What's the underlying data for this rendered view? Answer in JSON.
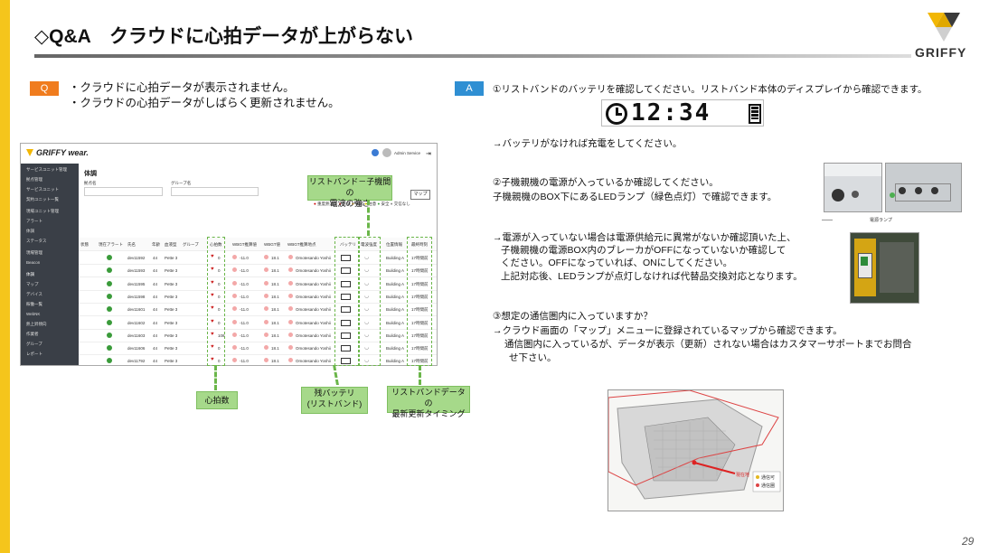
{
  "title": "◇Q&A　クラウドに心拍データが上がらない",
  "logo": {
    "name": "GRIFFY",
    "colors": [
      "#f2b705",
      "#3a3a3a",
      "#cfcfcf"
    ]
  },
  "question": {
    "badge": "Q",
    "lines": [
      "・クラウドに心拍データが表示されません。",
      "・クラウドの心拍データがしばらく更新されません。"
    ]
  },
  "answer": {
    "badge": "A",
    "step1": "①リストバンドのバッテリを確認してください。リストバンド本体のディスプレイから確認できます。",
    "display_time": "12:34",
    "step1_note": "→バッテリがなければ充電をしてください。",
    "step2_line1": "②子機親機の電源が入っているか確認してください。",
    "step2_line2": "子機親機のBOX下にあるLEDランプ（緑色点灯）で確認できます。",
    "photo_caption": "電源ランプ",
    "step2_note": [
      "→電源が入っていない場合は電源供給元に異常がないか確認頂いた上、",
      "子機親機の電源BOX内のブレーカがOFFになっていないか確認して",
      "ください。OFFになっていれば、ONにしてください。",
      "上記対応後、LEDランプが点灯しなければ代替品交換対応となります。"
    ],
    "step3_line1": "③想定の通信圏内に入っていますか？",
    "step3_line2": "→クラウド画面の「マップ」メニューに登録されているマップから確認できます。",
    "step3_line3": "通信圏内に入っているが、データが表示（更新）されない場合はカスタマーサポートまでお問合",
    "step3_line4": "せ下さい。"
  },
  "screenshot": {
    "brand": "GRIFFY wear.",
    "user": "Admin Service",
    "page_title": "体調",
    "filter1": "拠点名",
    "filter2": "グループ名",
    "map_button": "マップ",
    "legend": [
      "重度熱注意",
      "危険",
      "警戒",
      "注意",
      "安全",
      "交信なし"
    ],
    "sidebar": [
      "サービスユニット管理",
      "拠点管理",
      "サービスユニット",
      "契約ユニット一覧",
      "現場ユニット管理",
      "アラート",
      "体調",
      "ステータス",
      "現場管理",
      "Beacon",
      "体調",
      "マップ",
      "デバイス",
      "稼働一覧",
      "WebNK",
      "熱上昇傾向",
      "作業者",
      "グループ",
      "レポート"
    ],
    "columns": [
      "状態",
      "現在アラート",
      "氏名",
      "年齢",
      "血液型",
      "グループ",
      "心拍数",
      "WBGT推算値",
      "WBGT値",
      "WBGT推算地点",
      "バッテリ",
      "電波強度",
      "位置情報",
      "最終時刻"
    ],
    "rows": [
      {
        "name": "dev11592",
        "age": "44",
        "group": "Pette 3",
        "hr": "0",
        "wbgt": "-11.0",
        "temp": "18.1",
        "place": "Omotesando Yoshii",
        "loc": "Building A",
        "time": "17時間前"
      },
      {
        "name": "dev11593",
        "age": "44",
        "group": "Pette 3",
        "hr": "0",
        "wbgt": "-11.0",
        "temp": "18.1",
        "place": "Omotesando Yoshii",
        "loc": "Building A",
        "time": "17時間前"
      },
      {
        "name": "dev11595",
        "age": "44",
        "group": "Pette 3",
        "hr": "0",
        "wbgt": "-11.0",
        "temp": "18.1",
        "place": "Omotesando Yoshii",
        "loc": "Building A",
        "time": "17時間前"
      },
      {
        "name": "dev11598",
        "age": "44",
        "group": "Pette 3",
        "hr": "0",
        "wbgt": "-11.0",
        "temp": "18.1",
        "place": "Omotesando Yoshii",
        "loc": "Building A",
        "time": "17時間前"
      },
      {
        "name": "dev11601",
        "age": "44",
        "group": "Pette 3",
        "hr": "0",
        "wbgt": "-11.0",
        "temp": "18.1",
        "place": "Omotesando Yoshii",
        "loc": "Building A",
        "time": "17時間前"
      },
      {
        "name": "dev11602",
        "age": "44",
        "group": "Pette 3",
        "hr": "0",
        "wbgt": "-11.0",
        "temp": "18.1",
        "place": "Omotesando Yoshii",
        "loc": "Building A",
        "time": "17時間前"
      },
      {
        "name": "dev11603",
        "age": "44",
        "group": "Pette 3",
        "hr": "108",
        "wbgt": "-11.0",
        "temp": "18.1",
        "place": "Omotesando Yoshii",
        "loc": "Building A",
        "time": "17時間前"
      },
      {
        "name": "dev11606",
        "age": "44",
        "group": "Pette 3",
        "hr": "0",
        "wbgt": "-11.0",
        "temp": "18.1",
        "place": "Omotesando Yoshii",
        "loc": "Building A",
        "time": "17時間前"
      },
      {
        "name": "dev11792",
        "age": "44",
        "group": "Pette 3",
        "hr": "0",
        "wbgt": "-11.0",
        "temp": "18.1",
        "place": "Omotesando Yoshii",
        "loc": "Building A",
        "time": "17時間前"
      }
    ]
  },
  "callouts": {
    "signal": "リストバンド－子機間の\n電波の強さ",
    "heart": "心拍数",
    "battery": "残バッテリ\n(リストバンド)",
    "update": "リストバンドデータの\n最新更新タイミング"
  },
  "map": {
    "legend": [
      "通信可",
      "通信圏"
    ],
    "label": "現在地"
  },
  "page_number": "29"
}
